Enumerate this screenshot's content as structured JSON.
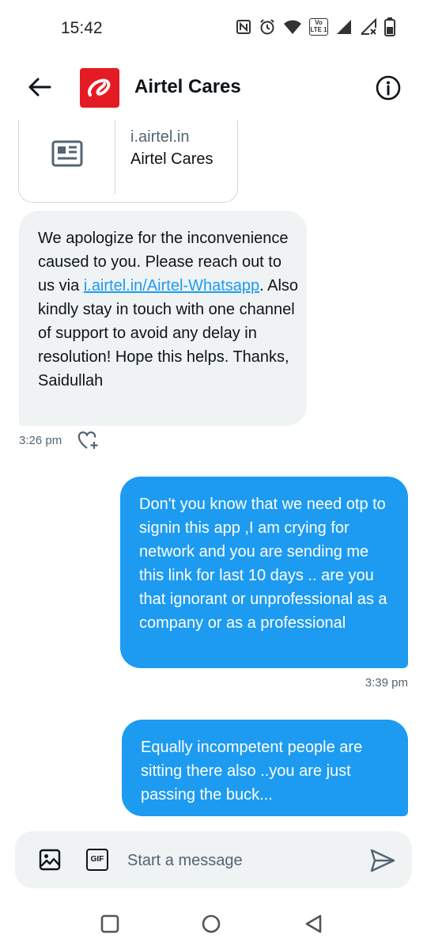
{
  "status_bar": {
    "time": "15:42",
    "volte_badge": "Vo LTE 1"
  },
  "header": {
    "title": "Airtel Cares",
    "back_icon": "arrow-left-icon",
    "info_icon": "info-icon"
  },
  "link_card": {
    "domain": "i.airtel.in",
    "title": "Airtel Cares",
    "icon": "newspaper-icon"
  },
  "messages": [
    {
      "direction": "incoming",
      "text_before": "We apologize for the inconvenience caused to you. Please reach out to us via ",
      "link": "i.airtel.in/Airtel-Whatsapp",
      "text_after": ". Also kindly stay in touch with one channel of support to avoid any delay in resolution! Hope this helps. Thanks, Saidullah",
      "time": "3:26 pm"
    },
    {
      "direction": "outgoing",
      "text": "Don't you know that we need otp to signin this app ,I am crying for network and you are sending me this link for last 10 days .. are you that ignorant or unprofessional as a company or as a professional",
      "time": "3:39 pm"
    },
    {
      "direction": "outgoing",
      "text": "Equally incompetent people are sitting there also ..you are just passing the buck..."
    }
  ],
  "composer": {
    "placeholder": "Start a message",
    "gif_label": "GIF"
  },
  "colors": {
    "accent": "#1d9bf0",
    "incoming_bubble": "#eff3f4",
    "brand_red": "#e51b24"
  }
}
